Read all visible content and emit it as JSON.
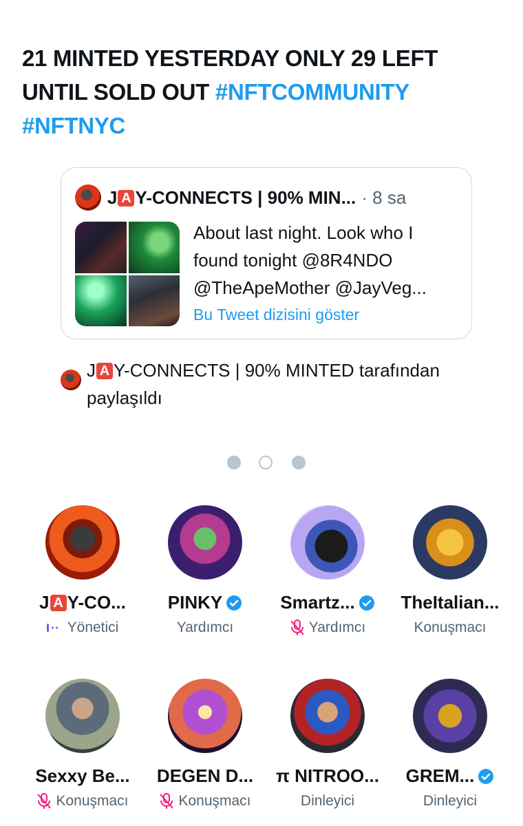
{
  "tweet": {
    "headline_plain": "21 MINTED YESTERDAY ONLY 29 LEFT UNTIL SOLD OUT ",
    "hashtags": [
      "#NFTCOMMUNITY",
      "#NFTNYC"
    ]
  },
  "quote": {
    "name_prefix": "J",
    "name_badge": "A",
    "name_suffix": "Y-CONNECTS | 90% MIN...",
    "time": "· 8 sa",
    "text": "About last night. Look who I found tonight @8R4NDO @TheApeMother @JayVeg...",
    "thread_link": "Bu Tweet dizisini göster"
  },
  "shared": {
    "prefix": "J",
    "badge": "A",
    "suffix": "Y-CONNECTS | 90% MINTED tarafından paylaşıldı"
  },
  "pager": {
    "count": 3,
    "active_index": 1
  },
  "participants": [
    {
      "name_prefix": "J",
      "badge": "A",
      "name": "Y-CO...",
      "verified": false,
      "role": "Yönetici",
      "role_icon": "host-icon",
      "color": "#7856ff"
    },
    {
      "name": "PINKY",
      "verified": true,
      "role": "Yardımcı",
      "role_icon": ""
    },
    {
      "name": "Smartz...",
      "verified": true,
      "role": "Yardımcı",
      "role_icon": "mic-off-icon"
    },
    {
      "name": "TheItalian...",
      "verified": false,
      "role": "Konuşmacı",
      "role_icon": ""
    },
    {
      "name": "Sexxy Be...",
      "verified": false,
      "role": "Konuşmacı",
      "role_icon": "mic-off-icon"
    },
    {
      "name": "DEGEN D...",
      "verified": false,
      "role": "Konuşmacı",
      "role_icon": "mic-off-icon"
    },
    {
      "name": "π NITROO...",
      "verified": false,
      "role": "Dinleyici",
      "role_icon": ""
    },
    {
      "name": "GREM...",
      "verified": true,
      "role": "Dinleyici",
      "role_icon": ""
    }
  ],
  "colors": {
    "link": "#1d9bf0",
    "muted": "#536471",
    "mic_off": "#f91880",
    "verified": "#1d9bf0",
    "border": "#cfd9de"
  }
}
